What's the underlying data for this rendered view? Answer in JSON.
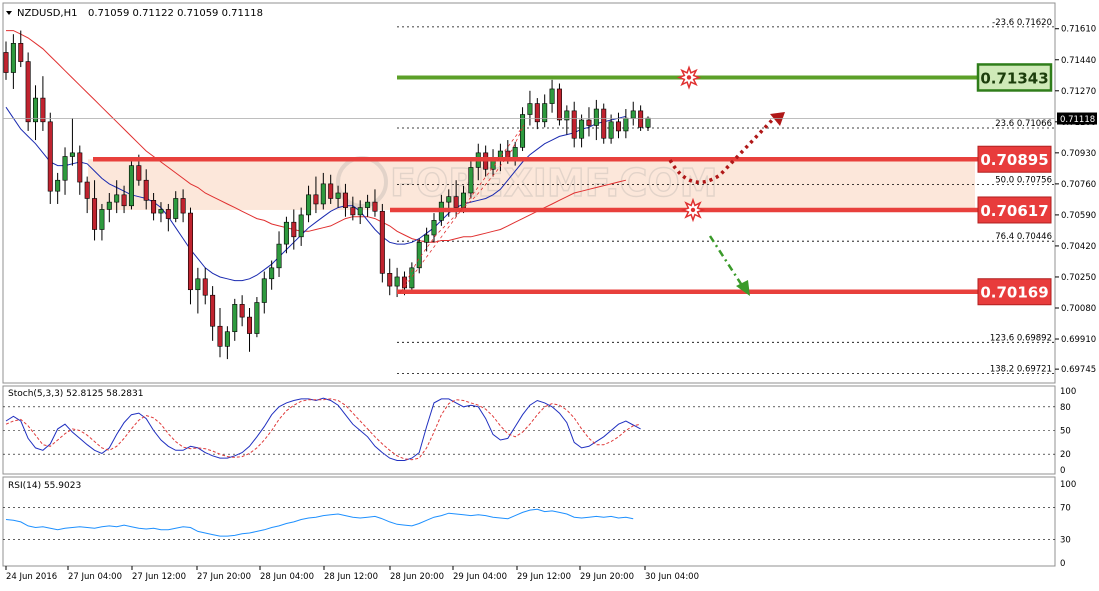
{
  "chart_data": [
    {
      "type": "candlestick",
      "symbol_label": "NZDUSD,H1",
      "ohlc_label": "0.71059 0.71122 0.71059 0.71118",
      "ylim": [
        0.6968,
        0.7174
      ],
      "price_ticks": [
        "0.71610",
        "0.71440",
        "0.71270",
        "0.71100",
        "0.70930",
        "0.70760",
        "0.70590",
        "0.70420",
        "0.70250",
        "0.70080",
        "0.69910",
        "0.69745"
      ],
      "price_tick_values": [
        0.7161,
        0.7144,
        0.7127,
        0.711,
        0.7093,
        0.7076,
        0.7059,
        0.7042,
        0.7025,
        0.7008,
        0.6991,
        0.69745
      ],
      "current_price": "0.71118",
      "current_price_value": 0.71118,
      "key_levels": [
        {
          "label": "0.71343",
          "value": 0.71343,
          "color": "#5ca028"
        },
        {
          "label": "0.70895",
          "value": 0.70895,
          "color": "#e8403c"
        },
        {
          "label": "0.70617",
          "value": 0.70617,
          "color": "#e8403c"
        },
        {
          "label": "0.70169",
          "value": 0.70169,
          "color": "#e8403c"
        }
      ],
      "fibonacci_levels": [
        {
          "label": "-23.6  0.71620",
          "value": 0.7162
        },
        {
          "label": "23.6  0.71066",
          "value": 0.71066
        },
        {
          "label": "50.0  0.70756",
          "value": 0.70756
        },
        {
          "label": "76.4  0.70446",
          "value": 0.70446
        },
        {
          "label": "123.6  0.69892",
          "value": 0.69892
        },
        {
          "label": "138.2  0.69721",
          "value": 0.69721
        }
      ],
      "resistance_zone": [
        0.70617,
        0.70895
      ],
      "time_labels": [
        "24 Jun 2016",
        "27 Jun 04:00",
        "27 Jun 12:00",
        "27 Jun 20:00",
        "28 Jun 04:00",
        "28 Jun 12:00",
        "28 Jun 20:00",
        "29 Jun 04:00",
        "29 Jun 12:00",
        "29 Jun 20:00",
        "30 Jun 04:00"
      ],
      "candles": [
        [
          0.7148,
          0.7154,
          0.7133,
          0.7137
        ],
        [
          0.7137,
          0.7158,
          0.7128,
          0.7153
        ],
        [
          0.7153,
          0.716,
          0.714,
          0.7143
        ],
        [
          0.7143,
          0.7148,
          0.7105,
          0.711
        ],
        [
          0.711,
          0.713,
          0.71,
          0.7123
        ],
        [
          0.7123,
          0.7135,
          0.7105,
          0.711
        ],
        [
          0.711,
          0.7115,
          0.7065,
          0.7072
        ],
        [
          0.7072,
          0.7082,
          0.7065,
          0.7078
        ],
        [
          0.7078,
          0.7096,
          0.707,
          0.7091
        ],
        [
          0.7091,
          0.7112,
          0.7086,
          0.7093
        ],
        [
          0.7093,
          0.7097,
          0.707,
          0.7077
        ],
        [
          0.7077,
          0.708,
          0.706,
          0.7068
        ],
        [
          0.7068,
          0.7078,
          0.7045,
          0.7051
        ],
        [
          0.7051,
          0.7065,
          0.7045,
          0.7062
        ],
        [
          0.7062,
          0.7071,
          0.7055,
          0.7066
        ],
        [
          0.7066,
          0.7078,
          0.706,
          0.707
        ],
        [
          0.707,
          0.7075,
          0.706,
          0.7064
        ],
        [
          0.7064,
          0.709,
          0.7062,
          0.7086
        ],
        [
          0.7086,
          0.7092,
          0.7075,
          0.7078
        ],
        [
          0.7078,
          0.7084,
          0.7062,
          0.7067
        ],
        [
          0.7067,
          0.7071,
          0.7056,
          0.706
        ],
        [
          0.706,
          0.7066,
          0.7055,
          0.7062
        ],
        [
          0.7062,
          0.7065,
          0.705,
          0.7057
        ],
        [
          0.7057,
          0.7072,
          0.7055,
          0.7068
        ],
        [
          0.7068,
          0.7073,
          0.7055,
          0.706
        ],
        [
          0.706,
          0.7063,
          0.701,
          0.7018
        ],
        [
          0.7018,
          0.703,
          0.7005,
          0.7024
        ],
        [
          0.7024,
          0.703,
          0.701,
          0.7015
        ],
        [
          0.7015,
          0.702,
          0.699,
          0.6998
        ],
        [
          0.6998,
          0.7008,
          0.6981,
          0.6987
        ],
        [
          0.6987,
          0.6998,
          0.698,
          0.6995
        ],
        [
          0.6995,
          0.7013,
          0.699,
          0.701
        ],
        [
          0.701,
          0.7015,
          0.6998,
          0.7003
        ],
        [
          0.7003,
          0.7008,
          0.6984,
          0.6994
        ],
        [
          0.6994,
          0.7014,
          0.6992,
          0.7011
        ],
        [
          0.7011,
          0.7028,
          0.7005,
          0.7024
        ],
        [
          0.7024,
          0.7034,
          0.7018,
          0.703
        ],
        [
          0.703,
          0.705,
          0.7025,
          0.7043
        ],
        [
          0.7043,
          0.7058,
          0.7038,
          0.7055
        ],
        [
          0.7055,
          0.7062,
          0.704,
          0.7047
        ],
        [
          0.7047,
          0.7063,
          0.7042,
          0.7059
        ],
        [
          0.7059,
          0.7075,
          0.7055,
          0.707
        ],
        [
          0.707,
          0.708,
          0.706,
          0.7065
        ],
        [
          0.7065,
          0.7082,
          0.7062,
          0.7076
        ],
        [
          0.7076,
          0.7081,
          0.7065,
          0.7068
        ],
        [
          0.7068,
          0.7075,
          0.7063,
          0.7071
        ],
        [
          0.7071,
          0.7076,
          0.7058,
          0.7063
        ],
        [
          0.7063,
          0.7069,
          0.7056,
          0.7059
        ],
        [
          0.7059,
          0.7067,
          0.7054,
          0.7063
        ],
        [
          0.7063,
          0.707,
          0.7058,
          0.7066
        ],
        [
          0.7066,
          0.7073,
          0.7058,
          0.7061
        ],
        [
          0.7061,
          0.7065,
          0.7022,
          0.7027
        ],
        [
          0.7027,
          0.7035,
          0.7015,
          0.702
        ],
        [
          0.702,
          0.703,
          0.7014,
          0.7025
        ],
        [
          0.7025,
          0.7028,
          0.7015,
          0.7019
        ],
        [
          0.7019,
          0.7033,
          0.7016,
          0.703
        ],
        [
          0.703,
          0.7046,
          0.7027,
          0.7044
        ],
        [
          0.7044,
          0.7052,
          0.7039,
          0.7048
        ],
        [
          0.7048,
          0.706,
          0.7044,
          0.7056
        ],
        [
          0.7056,
          0.707,
          0.7053,
          0.7066
        ],
        [
          0.7066,
          0.7073,
          0.7058,
          0.7069
        ],
        [
          0.7069,
          0.7078,
          0.7058,
          0.7063
        ],
        [
          0.7063,
          0.7075,
          0.706,
          0.7071
        ],
        [
          0.7071,
          0.709,
          0.7068,
          0.7085
        ],
        [
          0.7085,
          0.7098,
          0.7078,
          0.7093
        ],
        [
          0.7093,
          0.7097,
          0.708,
          0.7084
        ],
        [
          0.7084,
          0.7095,
          0.708,
          0.7089
        ],
        [
          0.7089,
          0.7098,
          0.7083,
          0.7094
        ],
        [
          0.7094,
          0.71,
          0.7087,
          0.709
        ],
        [
          0.709,
          0.7099,
          0.7086,
          0.7096
        ],
        [
          0.7096,
          0.7118,
          0.7094,
          0.7114
        ],
        [
          0.7114,
          0.7127,
          0.7108,
          0.712
        ],
        [
          0.712,
          0.7123,
          0.7106,
          0.711
        ],
        [
          0.711,
          0.7125,
          0.7107,
          0.712
        ],
        [
          0.712,
          0.7133,
          0.7115,
          0.7128
        ],
        [
          0.7128,
          0.7131,
          0.7108,
          0.7111
        ],
        [
          0.7111,
          0.7119,
          0.7103,
          0.7116
        ],
        [
          0.7116,
          0.7121,
          0.7096,
          0.7101
        ],
        [
          0.7101,
          0.7114,
          0.7096,
          0.7111
        ],
        [
          0.7111,
          0.7118,
          0.7102,
          0.7108
        ],
        [
          0.7108,
          0.7122,
          0.71,
          0.7117
        ],
        [
          0.7117,
          0.712,
          0.7098,
          0.7101
        ],
        [
          0.7101,
          0.7114,
          0.7098,
          0.711
        ],
        [
          0.711,
          0.7115,
          0.7101,
          0.7105
        ],
        [
          0.7105,
          0.7117,
          0.7101,
          0.7112
        ],
        [
          0.7112,
          0.7121,
          0.7108,
          0.7116
        ],
        [
          0.7116,
          0.7119,
          0.7105,
          0.7107
        ],
        [
          0.7107,
          0.7113,
          0.7105,
          0.7112
        ]
      ],
      "ma_slow": [
        0.716,
        0.716,
        0.7158,
        0.7156,
        0.7153,
        0.715,
        0.7146,
        0.7142,
        0.7138,
        0.7134,
        0.713,
        0.7126,
        0.7122,
        0.7118,
        0.7114,
        0.711,
        0.7106,
        0.7102,
        0.7098,
        0.7094,
        0.7091,
        0.7088,
        0.7085,
        0.7082,
        0.7079,
        0.7076,
        0.7074,
        0.7071,
        0.7069,
        0.7067,
        0.7065,
        0.7063,
        0.7061,
        0.7059,
        0.7057,
        0.7056,
        0.7054,
        0.7053,
        0.7052,
        0.7051,
        0.705,
        0.705,
        0.7051,
        0.7052,
        0.7053,
        0.7055,
        0.7057,
        0.7058,
        0.7058,
        0.7058,
        0.7057,
        0.7055,
        0.7053,
        0.705,
        0.7048,
        0.7046,
        0.7045,
        0.7044,
        0.7044,
        0.7045,
        0.7045,
        0.7046,
        0.7047,
        0.7047,
        0.7048,
        0.7049,
        0.705,
        0.7051,
        0.7053,
        0.7055,
        0.7057,
        0.7059,
        0.7061,
        0.7063,
        0.7065,
        0.7067,
        0.7069,
        0.7071,
        0.7072,
        0.7073,
        0.7074,
        0.7075,
        0.7076,
        0.7077,
        0.7078
      ],
      "ma_fast": [
        0.7118,
        0.7112,
        0.7106,
        0.7102,
        0.7098,
        0.7093,
        0.7088,
        0.7086,
        0.7086,
        0.7087,
        0.7088,
        0.7087,
        0.7083,
        0.7079,
        0.7076,
        0.7074,
        0.7072,
        0.707,
        0.7069,
        0.7068,
        0.7066,
        0.7063,
        0.7058,
        0.7052,
        0.7046,
        0.704,
        0.7035,
        0.703,
        0.7027,
        0.7025,
        0.7024,
        0.7023,
        0.7023,
        0.7024,
        0.7026,
        0.7029,
        0.7032,
        0.7036,
        0.704,
        0.7044,
        0.7048,
        0.7052,
        0.7055,
        0.7058,
        0.7061,
        0.7063,
        0.7064,
        0.7064,
        0.7061,
        0.7056,
        0.7051,
        0.7047,
        0.7044,
        0.7043,
        0.7043,
        0.7044,
        0.7046,
        0.7049,
        0.7052,
        0.7056,
        0.706,
        0.7063,
        0.7065,
        0.7066,
        0.7067,
        0.7068,
        0.707,
        0.7073,
        0.7078,
        0.7083,
        0.7088,
        0.7092,
        0.7095,
        0.7098,
        0.71,
        0.7102,
        0.7103,
        0.7104,
        0.7106,
        0.7107,
        0.7109,
        0.711,
        0.7111,
        0.7112,
        0.7113
      ]
    },
    {
      "type": "line",
      "title": "Stoch(5,3,3) 52.8125 58.2831",
      "ylim": [
        0,
        100
      ],
      "y_ticks": [
        "100",
        "80",
        "50",
        "20",
        "0"
      ],
      "y_tick_values": [
        100,
        80,
        50,
        20,
        0
      ],
      "series": [
        {
          "color": "#2030c0",
          "values": [
            62,
            68,
            62,
            40,
            28,
            25,
            33,
            52,
            58,
            48,
            40,
            32,
            25,
            21,
            28,
            45,
            60,
            70,
            72,
            65,
            50,
            38,
            30,
            25,
            25,
            30,
            28,
            22,
            18,
            15,
            15,
            18,
            22,
            30,
            42,
            55,
            70,
            80,
            85,
            88,
            90,
            90,
            88,
            91,
            88,
            82,
            70,
            58,
            50,
            42,
            30,
            22,
            15,
            12,
            12,
            15,
            22,
            55,
            85,
            90,
            90,
            85,
            80,
            82,
            80,
            65,
            45,
            38,
            40,
            55,
            70,
            82,
            88,
            85,
            80,
            72,
            60,
            35,
            28,
            30,
            36,
            42,
            50,
            58,
            62,
            57,
            52
          ]
        },
        {
          "color": "#e03c3c",
          "dash": true,
          "values": [
            58,
            62,
            64,
            56,
            44,
            32,
            30,
            38,
            46,
            52,
            50,
            44,
            36,
            28,
            25,
            30,
            40,
            52,
            63,
            69,
            66,
            58,
            46,
            36,
            29,
            27,
            28,
            27,
            24,
            20,
            17,
            16,
            17,
            21,
            28,
            38,
            50,
            64,
            75,
            82,
            87,
            89,
            89,
            89,
            90,
            88,
            82,
            72,
            62,
            52,
            42,
            33,
            25,
            18,
            14,
            13,
            15,
            28,
            48,
            70,
            84,
            89,
            88,
            85,
            82,
            77,
            68,
            56,
            46,
            42,
            48,
            58,
            70,
            80,
            84,
            82,
            76,
            66,
            52,
            40,
            32,
            32,
            36,
            42,
            50,
            56,
            58
          ]
        }
      ]
    },
    {
      "type": "line",
      "title": "RSI(14) 55.9023",
      "ylim": [
        0,
        100
      ],
      "y_ticks": [
        "100",
        "70",
        "30",
        "0"
      ],
      "y_tick_values": [
        100,
        70,
        30,
        0
      ],
      "series": [
        {
          "color": "#1e90ff",
          "values": [
            55,
            54,
            52,
            47,
            45,
            46,
            44,
            42,
            44,
            45,
            46,
            45,
            44,
            46,
            47,
            46,
            48,
            46,
            44,
            43,
            44,
            42,
            42,
            44,
            46,
            45,
            40,
            38,
            36,
            34,
            34,
            35,
            37,
            38,
            40,
            42,
            45,
            47,
            50,
            52,
            55,
            57,
            58,
            60,
            61,
            62,
            60,
            58,
            57,
            58,
            59,
            56,
            52,
            49,
            48,
            47,
            50,
            54,
            58,
            60,
            63,
            62,
            61,
            60,
            61,
            60,
            58,
            57,
            56,
            60,
            64,
            67,
            68,
            65,
            66,
            64,
            62,
            58,
            57,
            58,
            59,
            58,
            59,
            57,
            58,
            56
          ]
        }
      ]
    }
  ]
}
